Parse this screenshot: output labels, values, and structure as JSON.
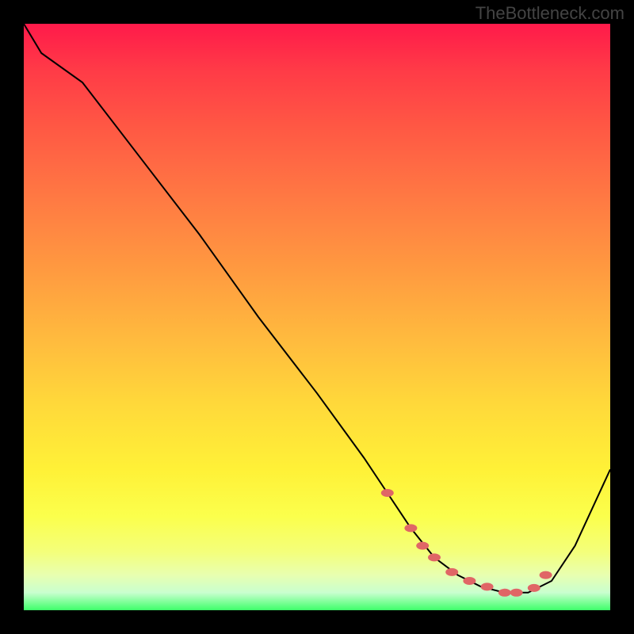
{
  "watermark": "TheBottleneck.com",
  "chart_data": {
    "type": "line",
    "title": "",
    "xlabel": "",
    "ylabel": "",
    "xlim": [
      0,
      100
    ],
    "ylim": [
      0,
      100
    ],
    "series": [
      {
        "name": "curve",
        "x": [
          0,
          3,
          10,
          20,
          30,
          40,
          50,
          58,
          62,
          66,
          70,
          74,
          78,
          82,
          86,
          90,
          94,
          100
        ],
        "y": [
          100,
          95,
          90,
          77,
          64,
          50,
          37,
          26,
          20,
          14,
          9,
          6,
          4,
          3,
          3,
          5,
          11,
          24
        ]
      }
    ],
    "highlight_points": {
      "name": "dots",
      "x": [
        62,
        66,
        68,
        70,
        73,
        76,
        79,
        82,
        84,
        87,
        89
      ],
      "y": [
        20,
        14,
        11,
        9,
        6.5,
        5,
        4,
        3,
        3,
        3.8,
        6
      ]
    }
  }
}
